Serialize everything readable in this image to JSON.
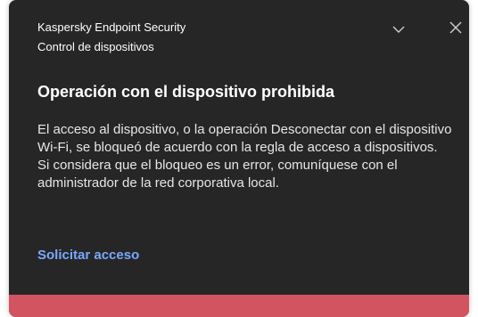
{
  "notification": {
    "app_name": "Kaspersky Endpoint Security",
    "component": "Control de dispositivos",
    "title": "Operación con el dispositivo prohibida",
    "message_line1": "El acceso al dispositivo, o la operación Desconectar con el dispositivo Wi-Fi, se bloqueó de acuerdo con la regla de acceso a dispositivos.",
    "message_line2": "Si considera que el bloqueo es un error, comuníquese con el administrador de la red corporativa local.",
    "action_link": "Solicitar acceso",
    "icons": {
      "expand": "chevron-down-icon",
      "close": "close-icon"
    }
  },
  "colors": {
    "background": "#262626",
    "text": "#ffffff",
    "link": "#7aa8ff",
    "status_bar": "#d25461"
  }
}
